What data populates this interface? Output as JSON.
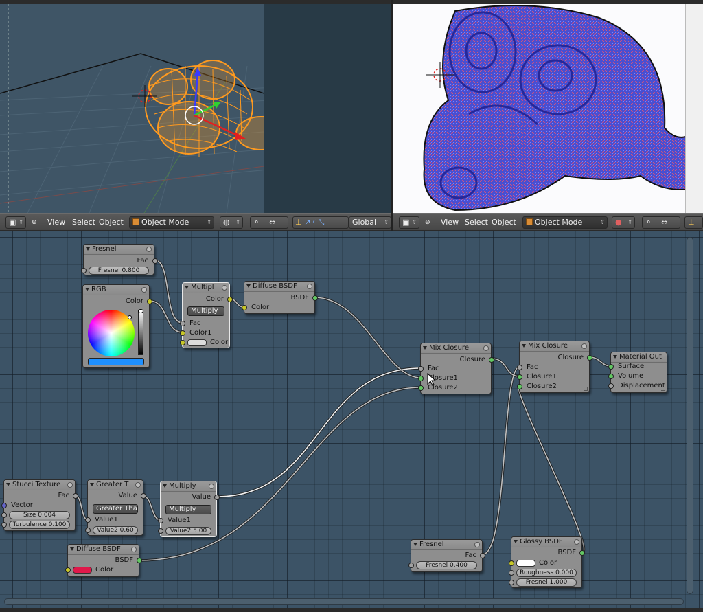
{
  "left_viewport": {
    "header": {
      "view": "View",
      "select": "Select",
      "object": "Object",
      "mode": "Object Mode",
      "orientation": "Global"
    }
  },
  "right_viewport": {
    "header": {
      "view": "View",
      "select": "Select",
      "object": "Object",
      "mode": "Object Mode"
    }
  },
  "nodes": {
    "fresnel_top": {
      "title": "Fresnel",
      "out_fac": "Fac",
      "field": "Fresnel 0.800"
    },
    "rgb": {
      "title": "RGB",
      "out_color": "Color",
      "swatch_color": "#1e90ff"
    },
    "multiply_top": {
      "title": "Multipl",
      "out_color": "Color",
      "operation": "Multiply",
      "in_fac": "Fac",
      "in_color1": "Color1",
      "in_color": "Color"
    },
    "diffuse_top": {
      "title": "Diffuse BSDF",
      "out_bsdf": "BSDF",
      "in_color": "Color"
    },
    "mix_closure_1": {
      "title": "Mix Closure",
      "out_closure": "Closure",
      "in_fac": "Fac",
      "in_closure1": "Closure1",
      "in_closure2": "Closure2"
    },
    "mix_closure_2": {
      "title": "Mix Closure",
      "out_closure": "Closure",
      "in_fac": "Fac",
      "in_closure1": "Closure1",
      "in_closure2": "Closure2"
    },
    "material_out": {
      "title": "Material Out",
      "in_surface": "Surface",
      "in_volume": "Volume",
      "in_displacement": "Displacement"
    },
    "stucci": {
      "title": "Stucci Texture",
      "out_fac": "Fac",
      "in_vector": "Vector",
      "size": "Size 0.004",
      "turbulence": "Turbulence 0.100"
    },
    "greater": {
      "title": "Greater T",
      "out_value": "Value",
      "operation": "Greater Tha",
      "in_value1": "Value1",
      "value2": "Value2 0.60"
    },
    "multiply_bottom": {
      "title": "Multiply",
      "out_value": "Value",
      "operation": "Multiply",
      "in_value1": "Value1",
      "value2": "Value2 5.00"
    },
    "diffuse_bottom": {
      "title": "Diffuse BSDF",
      "out_bsdf": "BSDF",
      "in_color": "Color",
      "swatch_color": "#e0184a"
    },
    "fresnel_bottom": {
      "title": "Fresnel",
      "out_fac": "Fac",
      "field": "Fresnel 0.400"
    },
    "glossy": {
      "title": "Glossy BSDF",
      "out_bsdf": "BSDF",
      "in_color": "Color",
      "roughness": "Roughness 0.000",
      "fresnel": "Fresnel 1.000",
      "swatch_color": "#ffffff"
    }
  },
  "colors": {
    "socket_shader": "#63c763",
    "socket_color": "#c7c729",
    "socket_value": "#a1a1a1",
    "socket_vector": "#6363c7",
    "wireframe": "#ff9a1f",
    "render_blue": "#4a4fd0"
  }
}
